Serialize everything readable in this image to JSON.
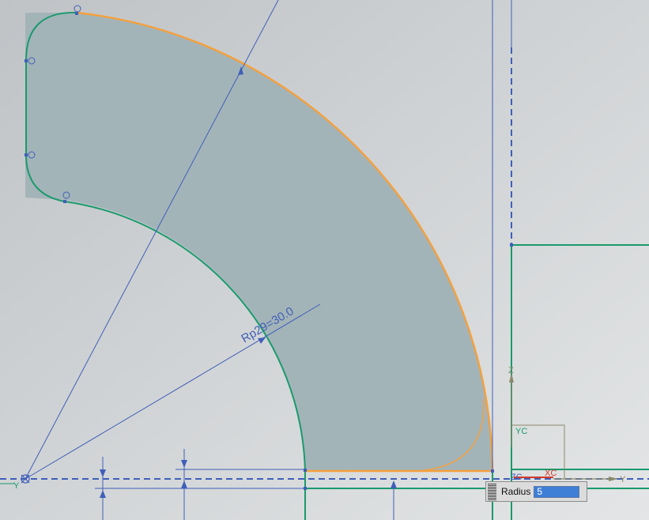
{
  "dimension": {
    "label": "Rp29=30.0"
  },
  "axes": {
    "zc": "Z",
    "yc": "YC",
    "zc_label": "ZC",
    "xc": "XC",
    "y_left": "Y",
    "y_right": "Y"
  },
  "radius_input": {
    "label": "Radius",
    "value": "5"
  },
  "colors": {
    "background": "#cfd2d4",
    "face": "#a3b4b9",
    "sketch_curve": "#1a9a6b",
    "selected_curve": "#f5a03c",
    "dimension": "#3f5fb8"
  }
}
